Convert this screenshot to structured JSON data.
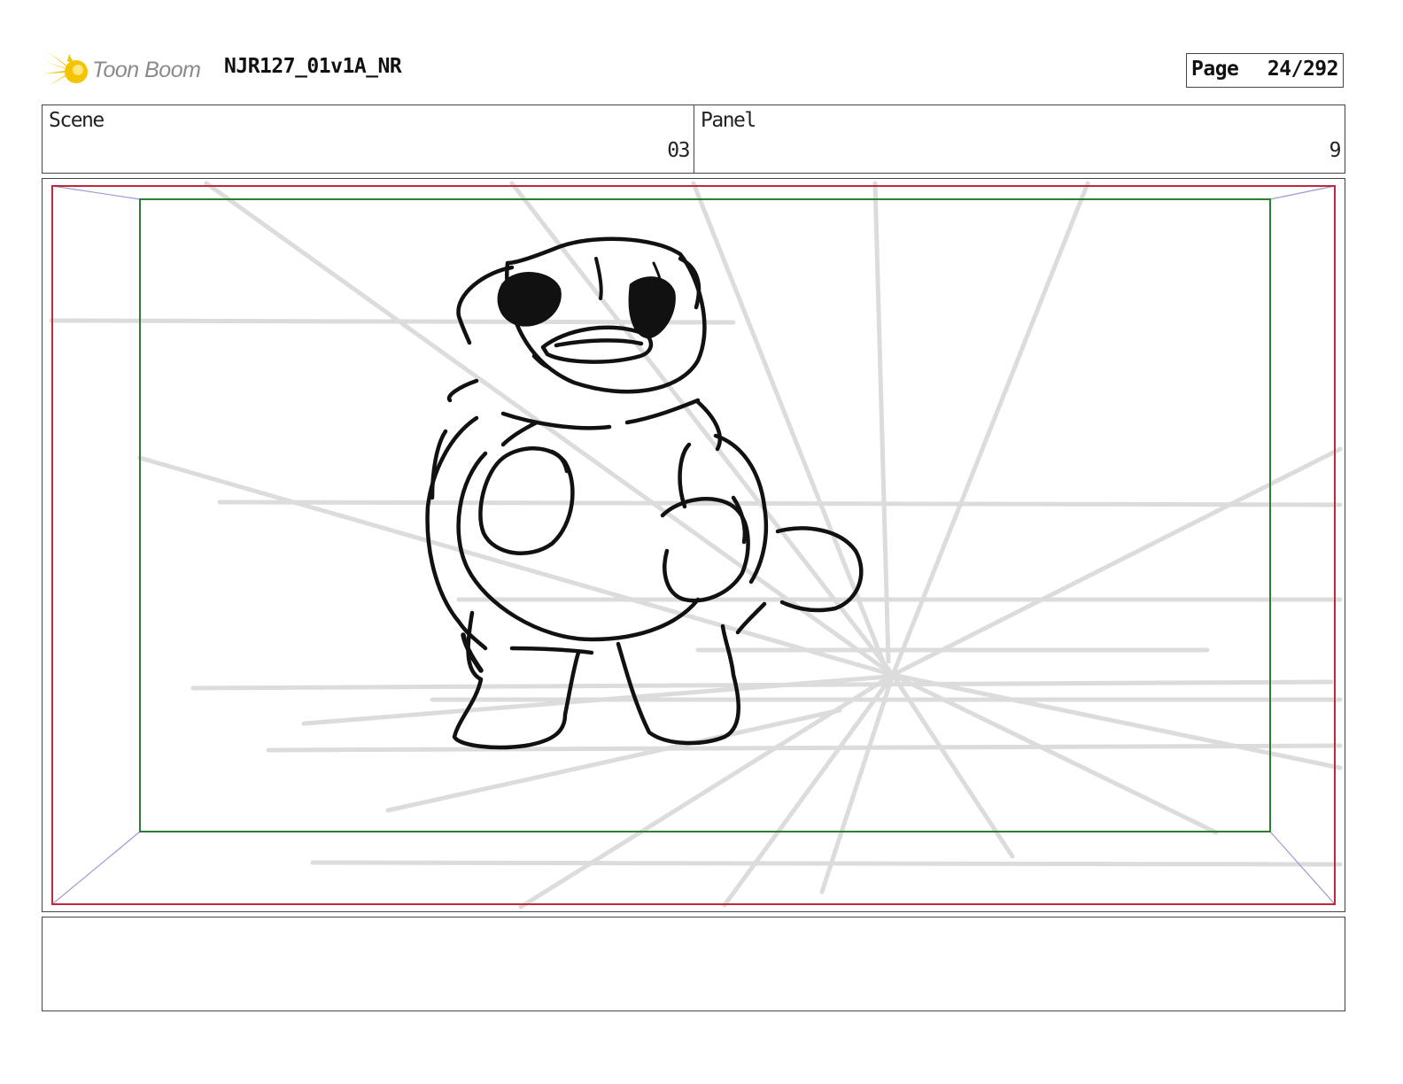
{
  "header": {
    "logo_text": "Toon Boom",
    "doc_title": "NJR127_01v1A_NR",
    "page_label": "Page",
    "page_number": "24/292"
  },
  "info": {
    "scene_label": "Scene",
    "scene_value": "03",
    "panel_label": "Panel",
    "panel_value": "9"
  },
  "panel": {
    "icon": "storyboard-sketch-turtle",
    "colors": {
      "outer_frame": "#c0283c",
      "safe_frame": "#2e7d32",
      "corner_lines": "#9a9ad8",
      "guide_lines": "#dadada",
      "sketch": "#111111"
    }
  },
  "notes": {
    "text": ""
  },
  "colors": {
    "logo_yellow": "#f5c400",
    "logo_text": "#8a8a8a",
    "border": "#444444"
  }
}
